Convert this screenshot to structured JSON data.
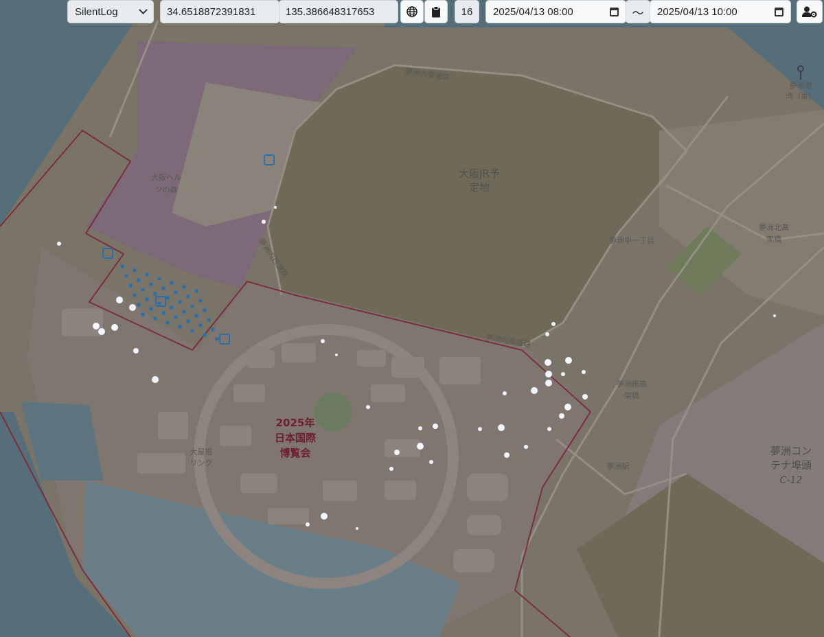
{
  "toolbar": {
    "log_select": {
      "selected": "SilentLog",
      "icon": "chevron-down-icon"
    },
    "latitude": "34.6518872391831",
    "longitude": "135.386648317653",
    "globe_button_icon": "globe-icon",
    "clipboard_button_icon": "clipboard-icon",
    "zoom": "16",
    "start_datetime": "2025/04/13 08:00",
    "range_separator": "〜",
    "end_datetime": "2025/04/13 10:00",
    "user_settings_icon": "user-gear-icon"
  },
  "map": {
    "labels": {
      "jr_site": [
        "大阪JR予",
        "定地"
      ],
      "expo": [
        "2025年",
        "日本国際",
        "博覧会"
      ],
      "yumeshima_1": "夢洲中一丁目",
      "north_overpass": [
        "夢洲北高",
        "架橋"
      ],
      "south_overpass": [
        "夢洲南高",
        "架橋"
      ],
      "container": [
        "夢洲コン",
        "テナ埠頭"
      ],
      "container_code": "C-12",
      "ring": [
        "大屋根",
        "リング"
      ],
      "forest": [
        "大阪ヘル",
        "ツの森"
      ],
      "road_north": "夢洲内東道路",
      "road_west": "夢洲内西道路",
      "road_south": "夢洲内南道路",
      "station": "夢洲駅",
      "top_right": [
        "夢洲港",
        "湾（事）"
      ]
    },
    "colors": {
      "water": "#566e79",
      "land": "#7a7468",
      "jr_site": "#6f6a58",
      "purple_zone": "#7c6a78",
      "expo_area": "#7f7670",
      "green": "#6e7a5a",
      "boundary": "#7a2e3e",
      "dot_white": "#f2f6ff",
      "dot_blue": "#2a6fa8"
    }
  }
}
